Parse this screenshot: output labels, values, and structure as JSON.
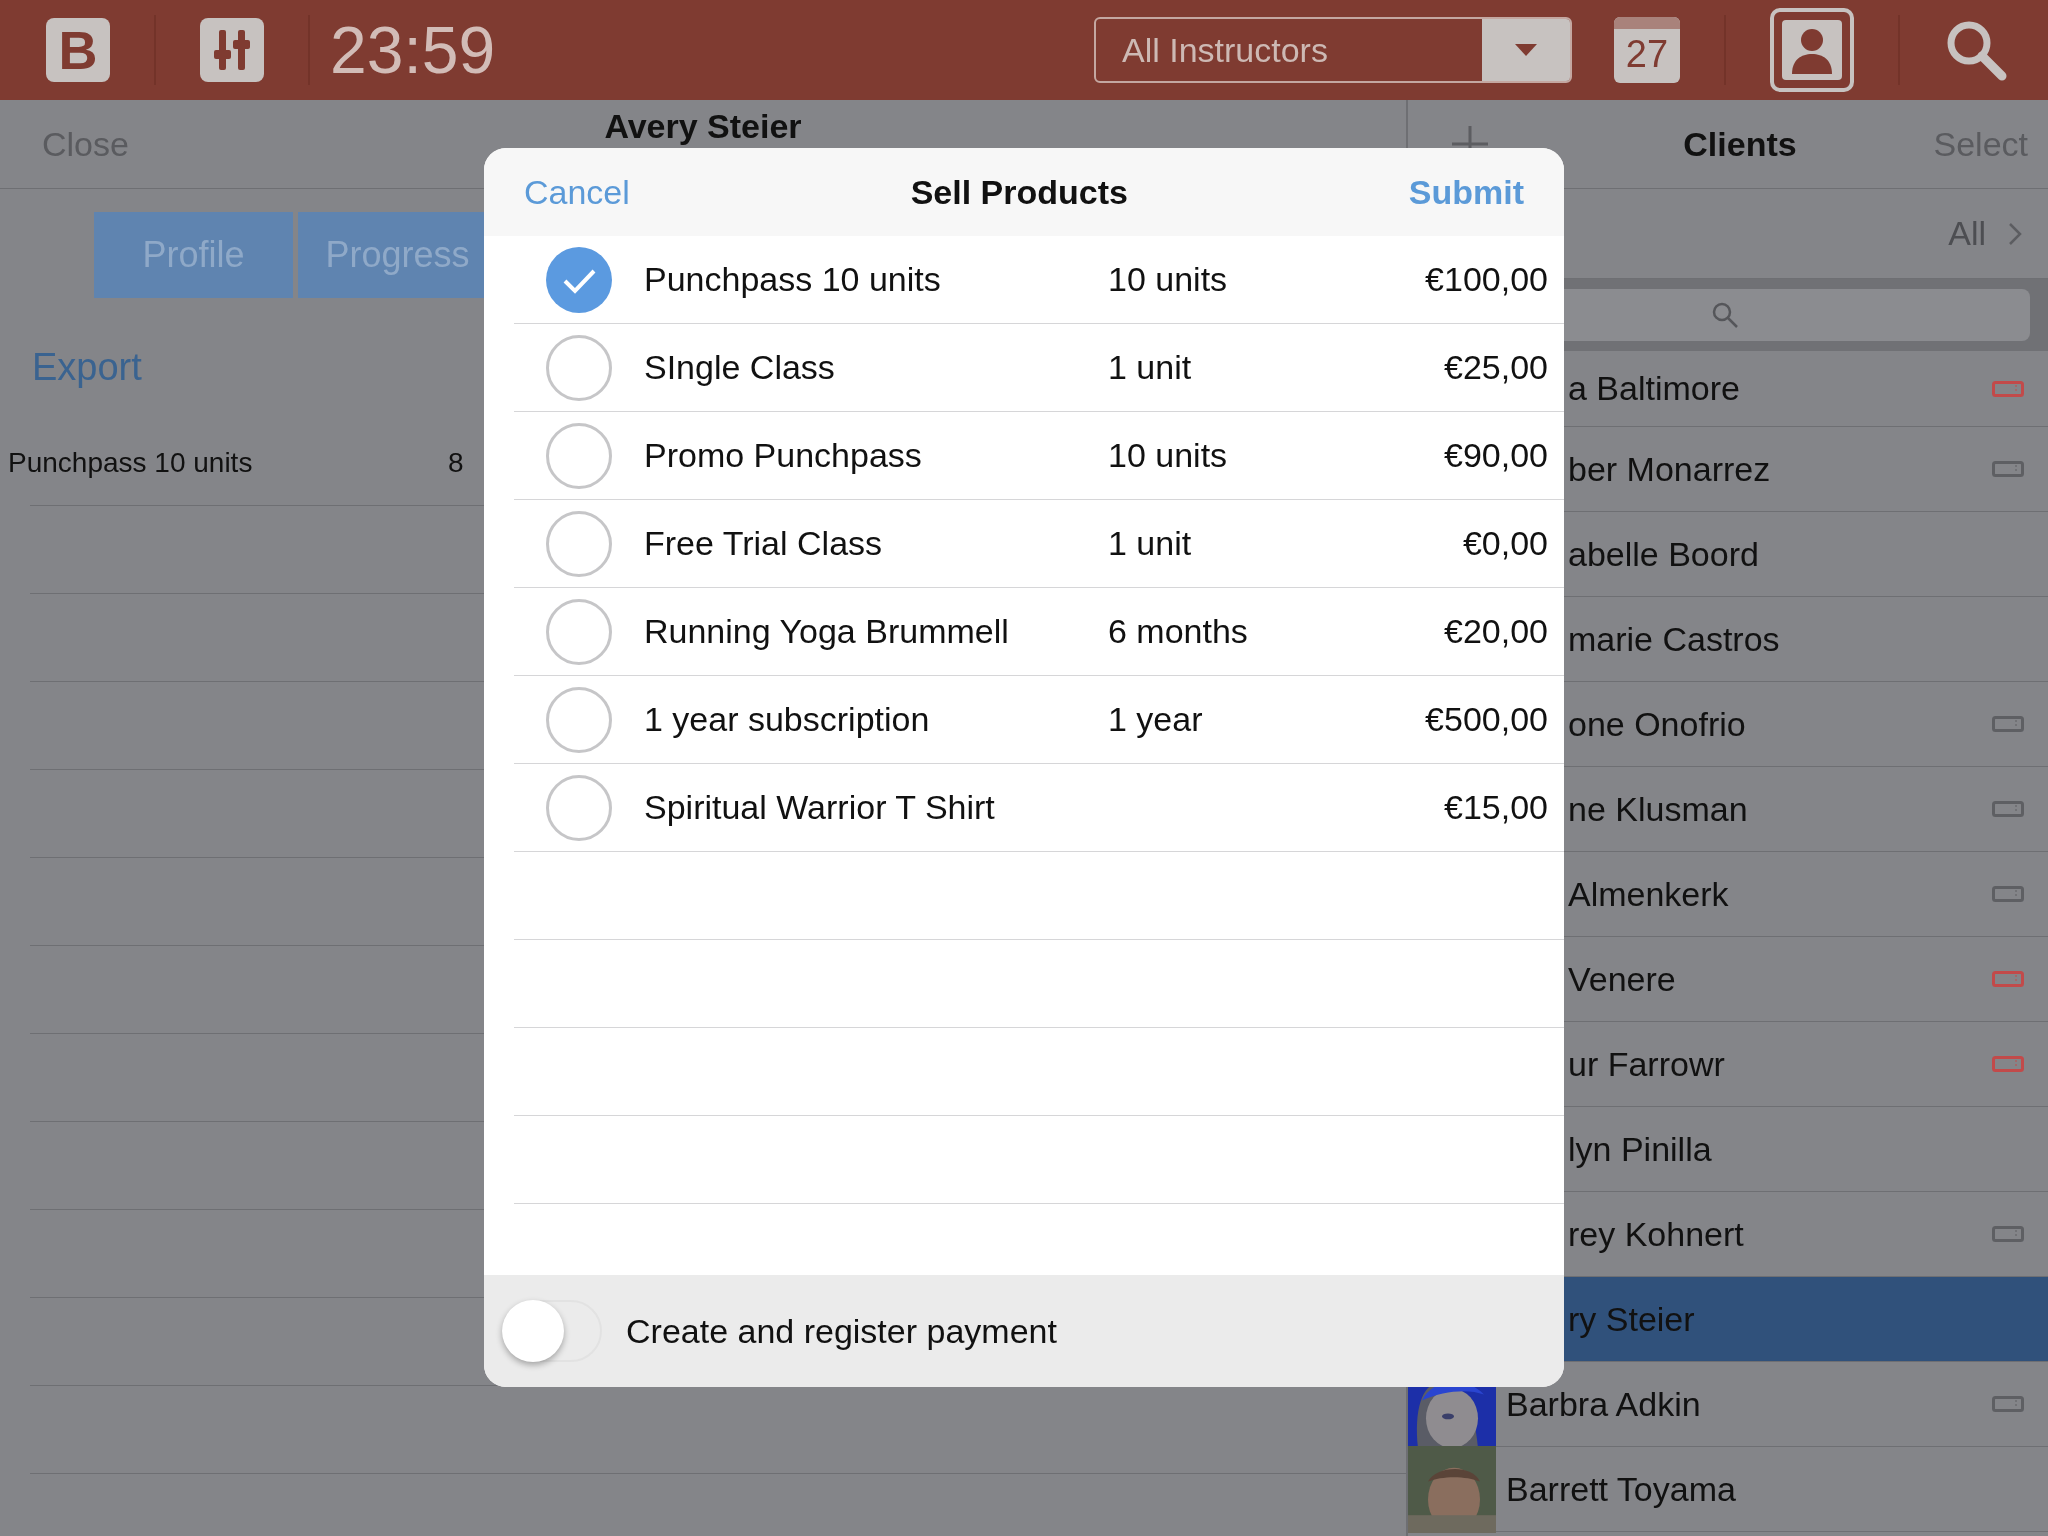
{
  "top_bar": {
    "logo": "B",
    "time": "23:59",
    "instructor_filter": {
      "value": "All Instructors"
    },
    "calendar_day": "27"
  },
  "detail": {
    "close": "Close",
    "title": "Avery Steier",
    "tabs": [
      {
        "label": "Profile",
        "selected": false
      },
      {
        "label": "Progress",
        "selected": false
      }
    ],
    "export": "Export",
    "rows": [
      {
        "name": "Punchpass 10 units",
        "value": "8"
      }
    ]
  },
  "clients": {
    "title": "Clients",
    "select": "Select",
    "filter": "All",
    "items": [
      {
        "name": "a Baltimore",
        "color": "#c24a4a",
        "selected": false
      },
      {
        "name": "ber Monarrez",
        "color": "#5e5f63",
        "selected": false
      },
      {
        "name": "abelle Boord",
        "selected": false
      },
      {
        "name": "marie Castros",
        "selected": false
      },
      {
        "name": "one Onofrio",
        "color": "#5e5f63",
        "selected": false
      },
      {
        "name": "ne Klusman",
        "color": "#5e5f63",
        "selected": false
      },
      {
        "name": "Almenkerk",
        "color": "#5e5f63",
        "selected": false
      },
      {
        "name": "Venere",
        "color": "#c24a4a",
        "selected": false
      },
      {
        "name": "ur Farrowr",
        "color": "#c24a4a",
        "selected": false
      },
      {
        "name": "lyn Pinilla",
        "selected": false
      },
      {
        "name": "rey Kohnert",
        "color": "#5e5f63",
        "selected": false
      },
      {
        "name": "ry Steier",
        "selected": true
      },
      {
        "name": "Barbra Adkin",
        "color": "#5e5f63",
        "selected": false
      },
      {
        "name": "Barrett Toyama",
        "selected": false
      }
    ]
  },
  "modal": {
    "cancel": "Cancel",
    "title": "Sell Products",
    "submit": "Submit",
    "products": [
      {
        "name": "Punchpass 10 units",
        "units": "10 units",
        "price": "€100,00",
        "selected": true
      },
      {
        "name": "SIngle Class",
        "units": "1 unit",
        "price": "€25,00",
        "selected": false
      },
      {
        "name": "Promo Punchpass",
        "units": "10 units",
        "price": "€90,00",
        "selected": false
      },
      {
        "name": "Free Trial Class",
        "units": "1 unit",
        "price": "€0,00",
        "selected": false
      },
      {
        "name": "Running Yoga Brummell",
        "units": "6 months",
        "price": "€20,00",
        "selected": false
      },
      {
        "name": "1 year subscription",
        "units": "1 year",
        "price": "€500,00",
        "selected": false
      },
      {
        "name": "Spiritual Warrior T Shirt",
        "price": "€15,00",
        "selected": false
      }
    ],
    "payment_toggle": {
      "label": "Create and register payment",
      "on": false
    }
  }
}
